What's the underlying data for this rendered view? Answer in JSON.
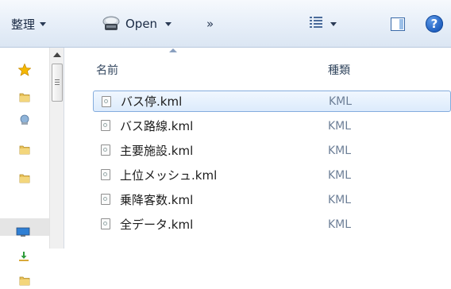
{
  "toolbar": {
    "organize_label": "整理",
    "open_label": "Open",
    "more_label": "»",
    "help_label": "?"
  },
  "columns": {
    "name": "名前",
    "type": "種類"
  },
  "files": [
    {
      "name": "バス停.kml",
      "type": "KML",
      "selected": true
    },
    {
      "name": "バス路線.kml",
      "type": "KML",
      "selected": false
    },
    {
      "name": "主要施設.kml",
      "type": "KML",
      "selected": false
    },
    {
      "name": "上位メッシュ.kml",
      "type": "KML",
      "selected": false
    },
    {
      "name": "乗降客数.kml",
      "type": "KML",
      "selected": false
    },
    {
      "name": "全データ.kml",
      "type": "KML",
      "selected": false
    }
  ],
  "icons": {
    "favorites": "star-icon",
    "folder": "folder-icon",
    "network": "network-icon",
    "computer": "computer-icon",
    "download": "download-folder-icon",
    "file": "kml-file-icon"
  },
  "colors": {
    "selection_border": "#84acdd",
    "selection_fill": "#dcebfc",
    "type_text": "#6d7f97"
  }
}
